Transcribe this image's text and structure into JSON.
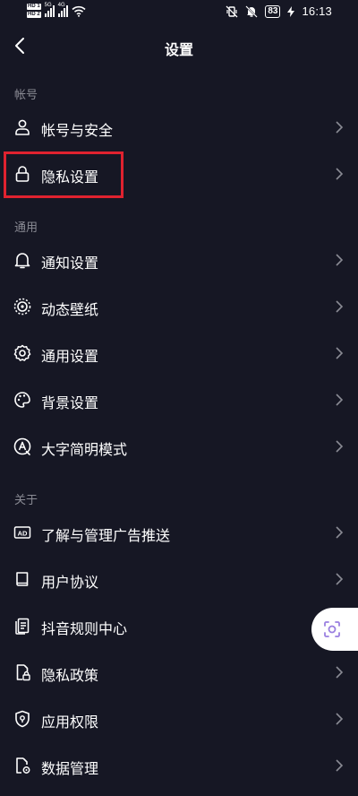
{
  "status_bar": {
    "hd1": "HD 1",
    "hd2": "HD 2",
    "net1": "5G",
    "net2": "4G",
    "battery": "83",
    "time": "16:13"
  },
  "header": {
    "title": "设置"
  },
  "sections": {
    "account": "帐号",
    "general": "通用",
    "about": "关于"
  },
  "items": [
    {
      "label": "帐号与安全",
      "icon": "person-icon"
    },
    {
      "label": "隐私设置",
      "icon": "lock-icon"
    },
    {
      "label": "通知设置",
      "icon": "bell-icon"
    },
    {
      "label": "动态壁纸",
      "icon": "wallpaper-icon"
    },
    {
      "label": "通用设置",
      "icon": "gear-icon"
    },
    {
      "label": "背景设置",
      "icon": "palette-icon"
    },
    {
      "label": "大字简明模式",
      "icon": "large-text-icon"
    },
    {
      "label": "了解与管理广告推送",
      "icon": "ad-icon"
    },
    {
      "label": "用户协议",
      "icon": "book-icon"
    },
    {
      "label": "抖音规则中心",
      "icon": "rules-icon"
    },
    {
      "label": "隐私政策",
      "icon": "privacy-policy-icon"
    },
    {
      "label": "应用权限",
      "icon": "shield-icon"
    },
    {
      "label": "数据管理",
      "icon": "data-icon"
    }
  ],
  "ad_icon_text": "AD",
  "colors": {
    "background": "#161724",
    "highlight": "#e0222f",
    "secondary_text": "#8a8b94"
  }
}
